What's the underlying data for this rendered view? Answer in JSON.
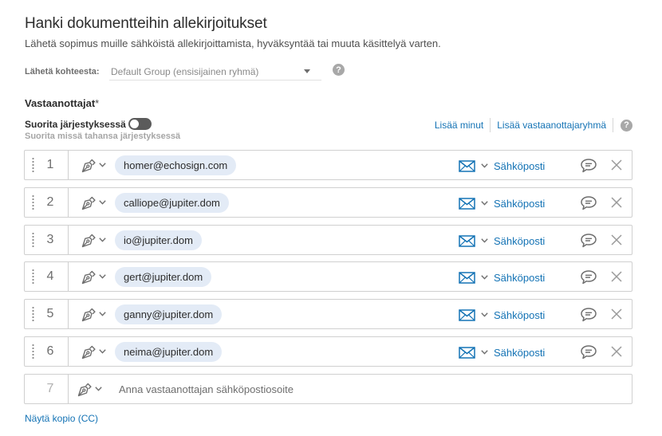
{
  "header": {
    "title": "Hanki dokumentteihin allekirjoitukset",
    "subtitle": "Lähetä sopimus muille sähköistä allekirjoittamista, hyväksyntää tai muuta käsittelyä varten."
  },
  "send_from": {
    "label": "Lähetä kohteesta:",
    "selected": "Default Group (ensisijainen ryhmä)",
    "help_icon": "?"
  },
  "recipients": {
    "title": "Vastaanottajat",
    "required_mark": "*",
    "order_toggle_label": "Suorita järjestyksessä",
    "order_toggle_on": false,
    "order_sublabel": "Suorita missä tahansa järjestyksessä",
    "add_me": "Lisää minut",
    "add_group": "Lisää vastaanottajaryhmä",
    "help_icon": "?",
    "rows": [
      {
        "number": "1",
        "email": "homer@echosign.com",
        "auth": "Sähköposti"
      },
      {
        "number": "2",
        "email": "calliope@jupiter.dom",
        "auth": "Sähköposti"
      },
      {
        "number": "3",
        "email": "io@jupiter.dom",
        "auth": "Sähköposti"
      },
      {
        "number": "4",
        "email": "gert@jupiter.dom",
        "auth": "Sähköposti"
      },
      {
        "number": "5",
        "email": "ganny@jupiter.dom",
        "auth": "Sähköposti"
      },
      {
        "number": "6",
        "email": "neima@jupiter.dom",
        "auth": "Sähköposti"
      }
    ],
    "new_row": {
      "number": "7",
      "placeholder": "Anna vastaanottajan sähköpostiosoite"
    }
  },
  "cc_link": "Näytä kopio (CC)",
  "icons": {
    "role": "pen-nib-icon",
    "auth": "envelope-icon",
    "message": "speech-bubble-icon",
    "remove": "close-icon"
  },
  "colors": {
    "link": "#1473b5",
    "chip": "#e3ebf6",
    "toggle_off": "#5b5b5b"
  }
}
